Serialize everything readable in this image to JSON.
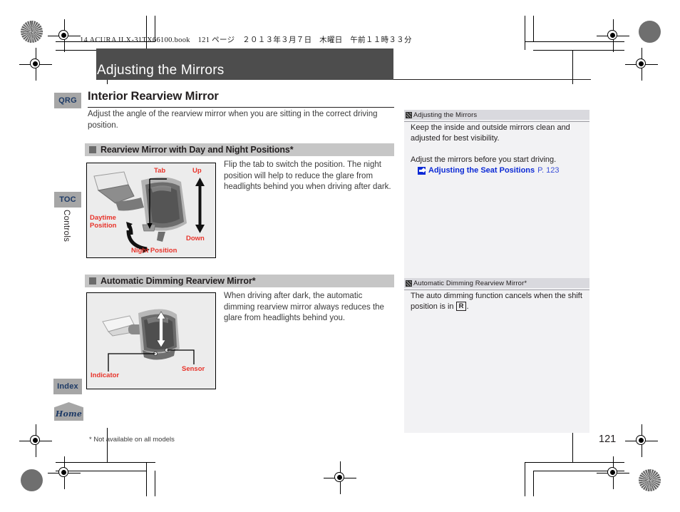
{
  "slug": "14 ACURA ILX-31TX66100.book　121 ページ　２０１３年３月７日　木曜日　午前１１時３３分",
  "chapter": {
    "title": "Adjusting the Mirrors"
  },
  "nav": {
    "qrg": "QRG",
    "toc": "TOC",
    "index": "Index",
    "home": "Home",
    "vertical_label": "Controls"
  },
  "main": {
    "section_title": "Interior Rearview Mirror",
    "intro": "Adjust the angle of the rearview mirror when you are sitting in the correct driving position.",
    "sub1": "Rearview Mirror with Day and Night Positions*",
    "body1": "Flip the tab to switch the position. The night position will help to reduce the glare from headlights behind you when driving after dark.",
    "sub2": "Automatic Dimming Rearview Mirror*",
    "body2": "When driving after dark, the automatic dimming rearview mirror always reduces the glare from headlights behind you."
  },
  "figure1": {
    "label_tab": "Tab",
    "label_up": "Up",
    "label_down": "Down",
    "label_daytime": "Daytime\nPosition",
    "label_night": "Night Position"
  },
  "figure2": {
    "label_indicator": "Indicator",
    "label_sensor": "Sensor"
  },
  "reference": {
    "head1": "Adjusting the Mirrors",
    "text1a": "Keep the inside and outside mirrors clean and adjusted for best visibility.",
    "text1b": "Adjust the mirrors before you start driving.",
    "link_label": "Adjusting the Seat Positions",
    "link_page": "P. 123",
    "head2": "Automatic Dimming Rearview Mirror*",
    "text2_before": "The auto dimming function cancels when the shift position is in ",
    "text2_box": "R",
    "text2_after": "."
  },
  "footer": {
    "footnote": "* Not available on all models",
    "page_number": "121"
  },
  "colors": {
    "chapter_bar": "#4d4d4d",
    "subhead_bar": "#c6c6c6",
    "nav_tab": "#a6a6a6",
    "nav_text": "#1d3a66",
    "ref_panel": "#f2f2f4",
    "link_blue": "#0c2ad6",
    "label_red": "#e8332a"
  }
}
